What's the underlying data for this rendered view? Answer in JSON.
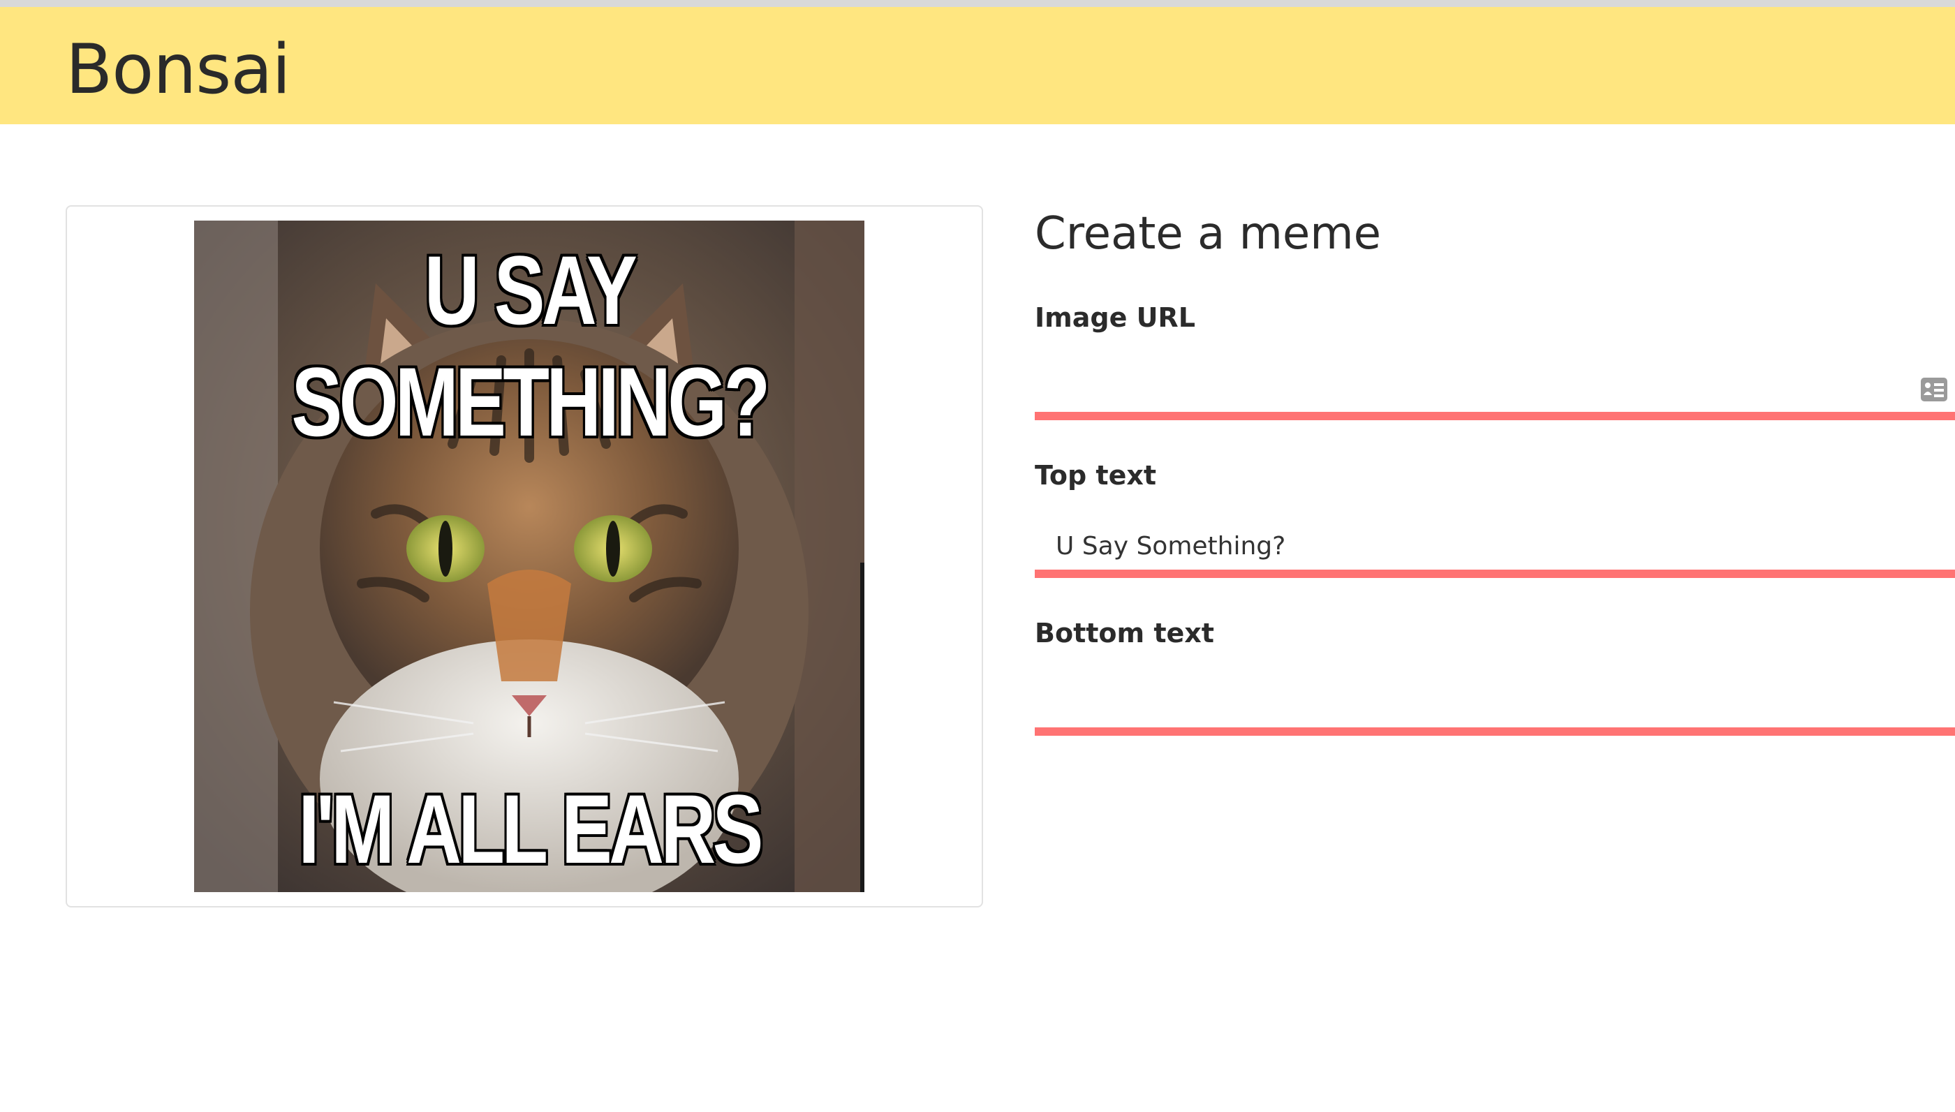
{
  "app": {
    "brand": "Bonsai"
  },
  "meme": {
    "top_text": "U SAY SOMETHING?",
    "bottom_text": "I'M ALL EARS",
    "image_alt": "cat-photo"
  },
  "form": {
    "title": "Create a meme",
    "fields": {
      "image_url": {
        "label": "Image URL",
        "value": ""
      },
      "top_text": {
        "label": "Top text",
        "value": "U Say Something?"
      },
      "bottom_text": {
        "label": "Bottom text",
        "value": ""
      }
    }
  },
  "colors": {
    "navbar": "#ffe680",
    "input_underline": "#ff7373",
    "card_border": "#e2e2e2"
  },
  "icons": {
    "autofill": "contact-card-icon"
  }
}
